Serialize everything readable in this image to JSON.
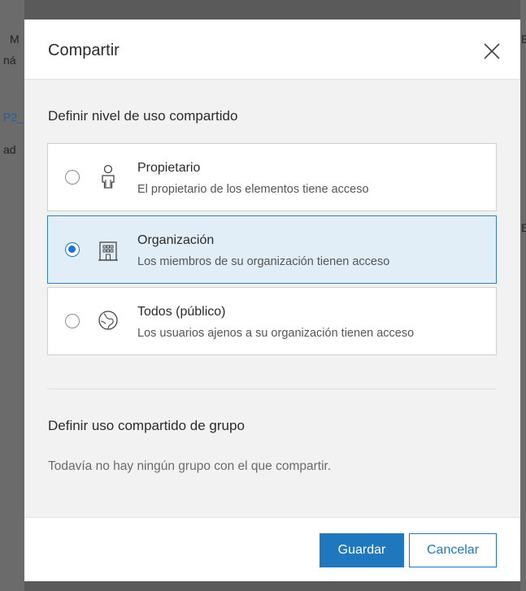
{
  "background": {
    "fragments": [
      "M",
      "ná",
      "P2_",
      "ad",
      "E",
      "E"
    ]
  },
  "dialog": {
    "title": "Compartir",
    "close_icon": "close-icon",
    "level_section": {
      "title": "Definir nivel de uso compartido",
      "options": [
        {
          "label": "Propietario",
          "description": "El propietario de los elementos tiene acceso",
          "icon": "person-icon",
          "selected": false
        },
        {
          "label": "Organización",
          "description": "Los miembros de su organización tienen acceso",
          "icon": "building-icon",
          "selected": true
        },
        {
          "label": "Todos (público)",
          "description": "Los usuarios ajenos a su organización tienen acceso",
          "icon": "globe-icon",
          "selected": false
        }
      ]
    },
    "group_section": {
      "title": "Definir uso compartido de grupo",
      "empty_message": "Todavía no hay ningún grupo con el que compartir."
    },
    "footer": {
      "save_label": "Guardar",
      "cancel_label": "Cancelar"
    }
  },
  "colors": {
    "accent": "#1f78bd",
    "selected_bg": "#e1eef8",
    "overlay": "#5a5a5a"
  }
}
